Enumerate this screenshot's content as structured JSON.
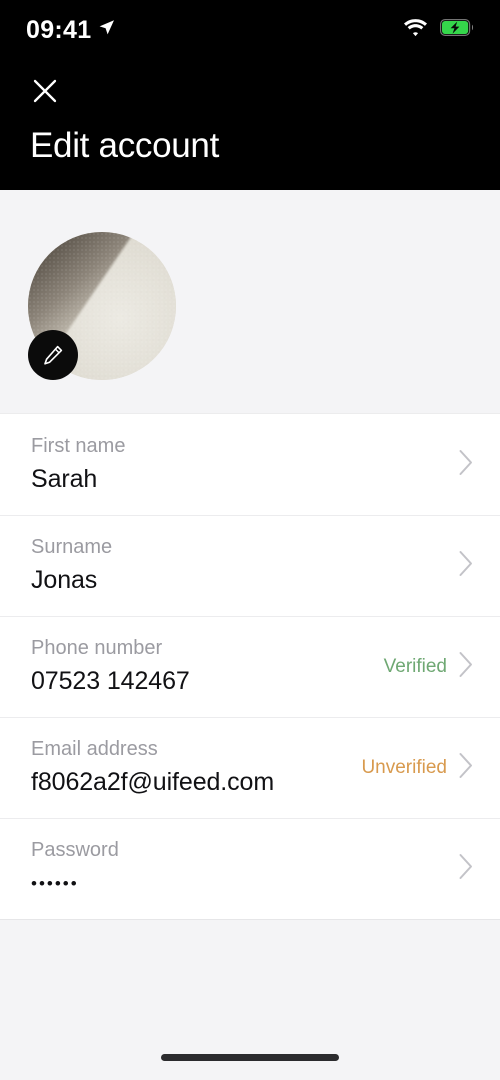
{
  "status_bar": {
    "time": "09:41",
    "location_icon": "location-arrow-icon",
    "wifi_icon": "wifi-icon",
    "battery_icon": "battery-charging-icon",
    "battery_color": "#35d64b"
  },
  "header": {
    "close_icon": "close-icon",
    "title": "Edit account",
    "background": "#000000"
  },
  "profile": {
    "avatar_name": "profile-avatar",
    "edit_badge_icon": "pencil-icon"
  },
  "fields": [
    {
      "name": "first-name",
      "label": "First name",
      "value": "Sarah",
      "badge": "",
      "badge_state": "",
      "masked": false
    },
    {
      "name": "surname",
      "label": "Surname",
      "value": "Jonas",
      "badge": "",
      "badge_state": "",
      "masked": false
    },
    {
      "name": "phone-number",
      "label": "Phone number",
      "value": "07523 142467",
      "badge": "Verified",
      "badge_state": "verified",
      "masked": false
    },
    {
      "name": "email-address",
      "label": "Email address",
      "value": "f8062a2f@uifeed.com",
      "badge": "Unverified",
      "badge_state": "unverified",
      "masked": false
    },
    {
      "name": "password",
      "label": "Password",
      "value": "••••••",
      "badge": "",
      "badge_state": "",
      "masked": true
    }
  ],
  "colors": {
    "verified": "#6fa873",
    "unverified": "#d89a4e",
    "label": "#9b9ba1",
    "value": "#111114",
    "page_background": "#f4f4f6",
    "card_background": "#ffffff"
  },
  "bottom": {
    "home_indicator": "home-indicator"
  }
}
